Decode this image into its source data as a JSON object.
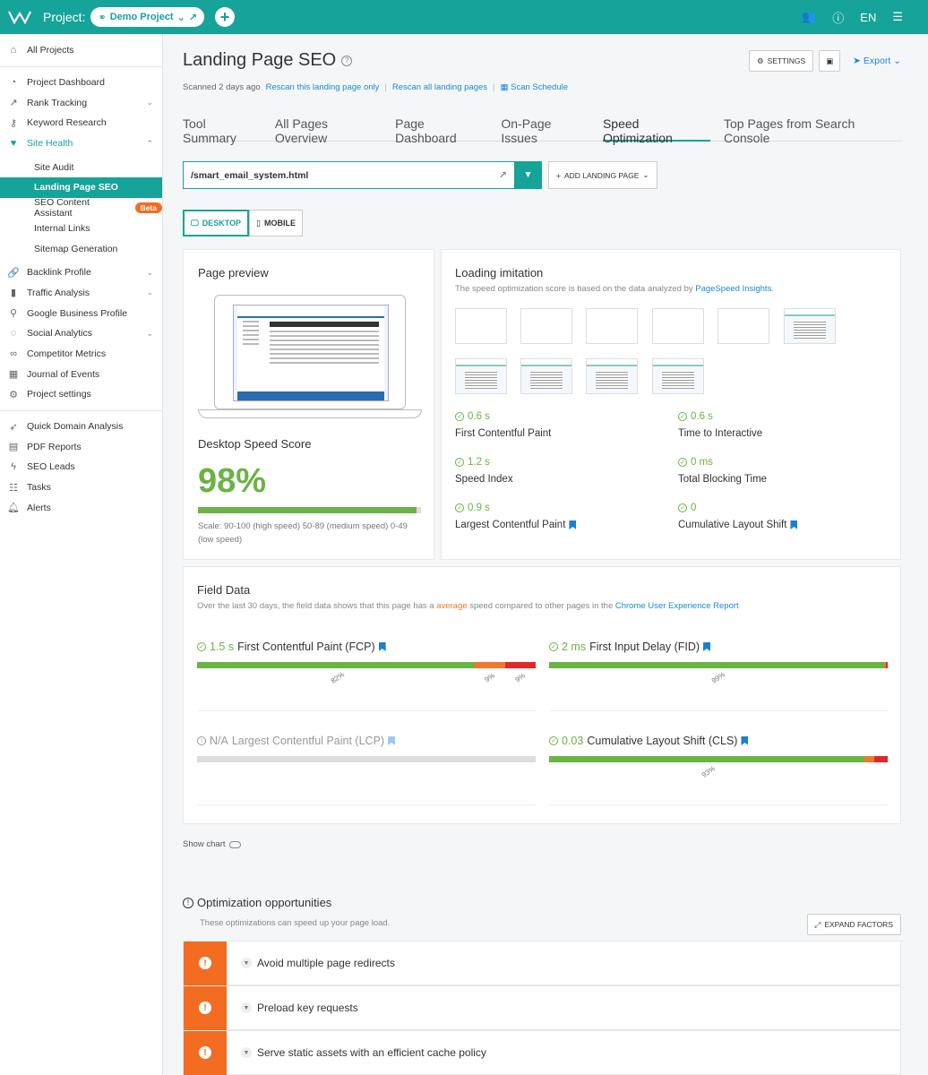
{
  "topbar": {
    "project_label": "Project:",
    "project_name": "Demo Project",
    "language": "EN"
  },
  "sidebar": {
    "items": [
      {
        "label": "All Projects",
        "icon": "home-icon"
      },
      {
        "label": "Project Dashboard",
        "icon": "gauge-icon"
      },
      {
        "label": "Rank Tracking",
        "icon": "trend-icon"
      },
      {
        "label": "Keyword Research",
        "icon": "key-icon"
      },
      {
        "label": "Site Health",
        "icon": "heart-icon"
      },
      {
        "label": "Site Audit"
      },
      {
        "label": "Landing Page SEO"
      },
      {
        "label": "SEO Content Assistant",
        "badge": "Beta"
      },
      {
        "label": "Internal Links"
      },
      {
        "label": "Sitemap Generation"
      },
      {
        "label": "Backlink Profile",
        "icon": "link-icon"
      },
      {
        "label": "Traffic Analysis",
        "icon": "bars-icon"
      },
      {
        "label": "Google Business Profile",
        "icon": "pin-icon"
      },
      {
        "label": "Social Analytics",
        "icon": "chat-icon"
      },
      {
        "label": "Competitor Metrics",
        "icon": "binoculars-icon"
      },
      {
        "label": "Journal of Events",
        "icon": "calendar-icon"
      },
      {
        "label": "Project settings",
        "icon": "gear-icon"
      },
      {
        "label": "Quick Domain Analysis",
        "icon": "rocket-icon"
      },
      {
        "label": "PDF Reports",
        "icon": "pdf-icon"
      },
      {
        "label": "SEO Leads",
        "icon": "bolt-icon"
      },
      {
        "label": "Tasks",
        "icon": "tasks-icon"
      },
      {
        "label": "Alerts",
        "icon": "bell-icon"
      }
    ]
  },
  "header": {
    "title": "Landing Page SEO",
    "settings_label": "SETTINGS",
    "export_label": "Export",
    "scanned": "Scanned 2 days ago",
    "rescan_page": "Rescan this landing page only",
    "rescan_all": "Rescan all landing pages",
    "scan_schedule": "Scan Schedule"
  },
  "tabs": [
    {
      "label": "Tool Summary"
    },
    {
      "label": "All Pages Overview"
    },
    {
      "label": "Page Dashboard"
    },
    {
      "label": "On-Page Issues"
    },
    {
      "label": "Speed Optimization",
      "active": true
    },
    {
      "label": "Top Pages from Search Console"
    }
  ],
  "url_selector": {
    "value": "/smart_email_system.html",
    "add_label": "ADD LANDING PAGE"
  },
  "device": {
    "desktop": "DESKTOP",
    "mobile": "MOBILE"
  },
  "preview": {
    "title": "Page preview",
    "score_title": "Desktop Speed Score",
    "score": "98%",
    "score_value": 98,
    "scale": "Scale: 90-100 (high speed) 50-89 (medium speed) 0-49 (low speed)"
  },
  "loading": {
    "title": "Loading imitation",
    "subtitle": "The speed optimization score is based on the data analyzed by",
    "subtitle_link": "PageSpeed Insights",
    "subtitle_end": ".",
    "metrics": [
      {
        "value": "0.6 s",
        "label": "First Contentful Paint"
      },
      {
        "value": "0.6 s",
        "label": "Time to Interactive"
      },
      {
        "value": "1.2 s",
        "label": "Speed Index"
      },
      {
        "value": "0 ms",
        "label": "Total Blocking Time"
      },
      {
        "value": "0.9 s",
        "label": "Largest Contentful Paint"
      },
      {
        "value": "0",
        "label": "Cumulative Layout Shift"
      }
    ]
  },
  "field_data": {
    "title": "Field Data",
    "desc_start": "Over the last 30 days, the field data shows that this page has a",
    "desc_highlight": "average",
    "desc_mid": "speed compared to other pages in the",
    "desc_link": "Chrome User Experience Report",
    "metrics": [
      {
        "value": "1.5 s",
        "label": "First Contentful Paint (FCP)",
        "segments": [
          82,
          9,
          9
        ],
        "labels": [
          "82%",
          "9%",
          "9%"
        ]
      },
      {
        "value": "2 ms",
        "label": "First Input Delay (FID)",
        "segments": [
          99,
          0.5,
          0.5
        ],
        "labels": [
          "99%"
        ]
      },
      {
        "value": "N/A",
        "label": "Largest Contentful Paint (LCP)",
        "segments": [],
        "labels": []
      },
      {
        "value": "0.03",
        "label": "Cumulative Layout Shift (CLS)",
        "segments": [
          93,
          3,
          4
        ],
        "labels": [
          "93%"
        ]
      }
    ],
    "colors": {
      "good": "#6ab345",
      "medium": "#f0782c",
      "bad": "#e3262a"
    }
  },
  "show_chart": "Show chart",
  "opportunities": {
    "title": "Optimization opportunities",
    "subtitle": "These optimizations can speed up your page load.",
    "expand_label": "EXPAND FACTORS",
    "items": [
      {
        "label": "Avoid multiple page redirects"
      },
      {
        "label": "Preload key requests"
      },
      {
        "label": "Serve static assets with an efficient cache policy"
      }
    ]
  }
}
